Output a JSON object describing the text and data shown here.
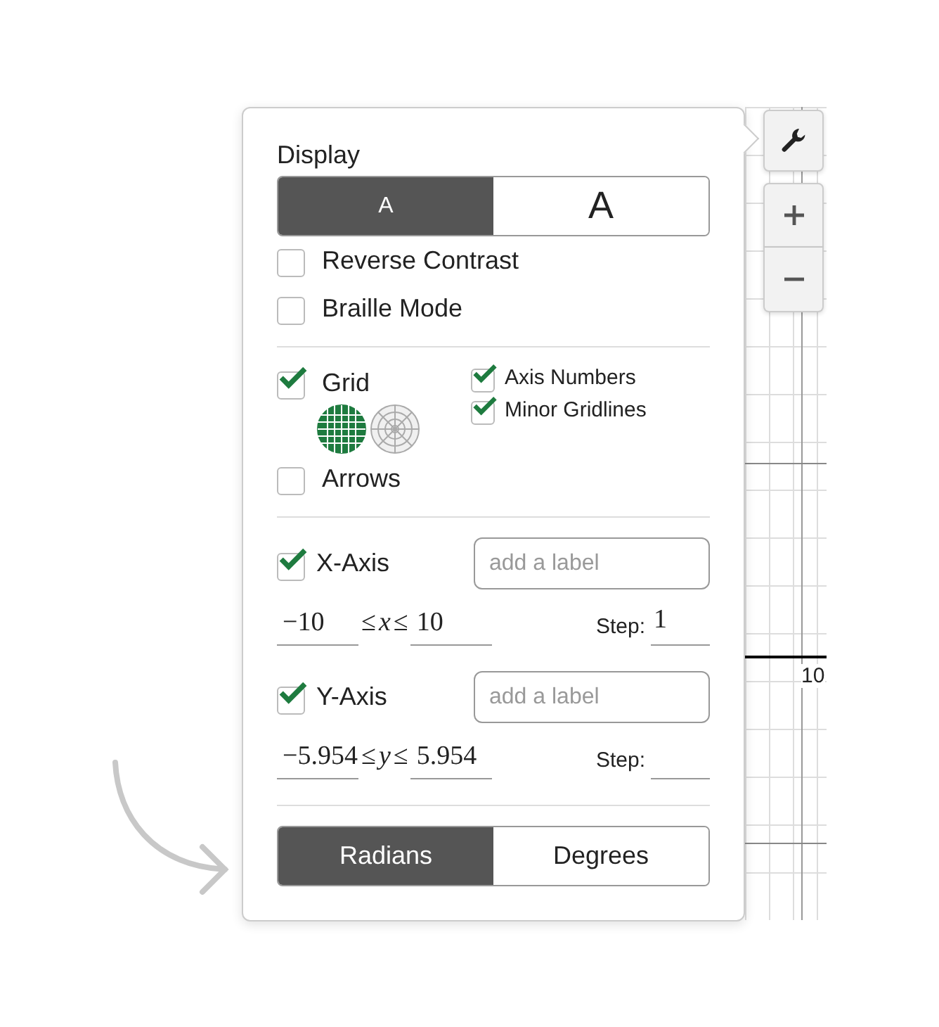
{
  "graph": {
    "axis_label": "10"
  },
  "display": {
    "title": "Display",
    "text_sizes": [
      {
        "label": "A",
        "selected": true
      },
      {
        "label": "A",
        "selected": false
      }
    ]
  },
  "accessibility": [
    {
      "label": "Reverse Contrast",
      "checked": false
    },
    {
      "label": "Braille Mode",
      "checked": false
    }
  ],
  "grid": {
    "label": "Grid",
    "checked": true,
    "types": [
      {
        "kind": "cartesian",
        "selected": true
      },
      {
        "kind": "polar",
        "selected": false
      }
    ]
  },
  "grid_options": [
    {
      "label": "Axis Numbers",
      "checked": true
    },
    {
      "label": "Minor Gridlines",
      "checked": true
    }
  ],
  "arrows": {
    "label": "Arrows",
    "checked": false
  },
  "axes": [
    {
      "label": "X-Axis",
      "checked": true,
      "placeholder": "add a label",
      "min": "−10",
      "relation": "≤",
      "variable": "x",
      "max": "10",
      "step_label": "Step:",
      "step": "1"
    },
    {
      "label": "Y-Axis",
      "checked": true,
      "placeholder": "add a label",
      "min": "−5.954",
      "relation": "≤",
      "variable": "y",
      "max": "5.954",
      "step_label": "Step:"
    }
  ],
  "angle_units": [
    {
      "label": "Radians",
      "selected": true
    },
    {
      "label": "Degrees",
      "selected": false
    }
  ]
}
